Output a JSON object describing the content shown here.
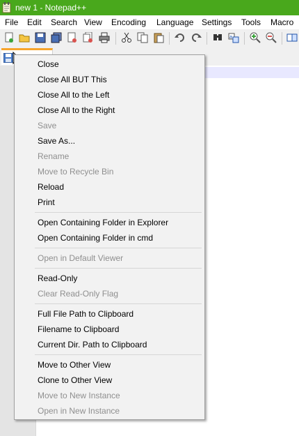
{
  "window": {
    "title": "new 1 - Notepad++"
  },
  "menubar": {
    "items": [
      "File",
      "Edit",
      "Search",
      "View",
      "Encoding",
      "Language",
      "Settings",
      "Tools",
      "Macro"
    ]
  },
  "toolbar": {
    "icons": [
      "new-file-icon",
      "open-file-icon",
      "save-icon",
      "save-all-icon",
      "close-icon",
      "close-all-icon",
      "print-icon",
      "cut-icon",
      "copy-icon",
      "paste-icon",
      "undo-icon",
      "redo-icon",
      "find-icon",
      "replace-icon",
      "zoom-in-icon",
      "zoom-out-icon",
      "sync-view-icon"
    ]
  },
  "context_menu": {
    "groups": [
      [
        {
          "label": "Close",
          "enabled": true
        },
        {
          "label": "Close All BUT This",
          "enabled": true
        },
        {
          "label": "Close All to the Left",
          "enabled": true
        },
        {
          "label": "Close All to the Right",
          "enabled": true
        },
        {
          "label": "Save",
          "enabled": false
        },
        {
          "label": "Save As...",
          "enabled": true
        },
        {
          "label": "Rename",
          "enabled": false
        },
        {
          "label": "Move to Recycle Bin",
          "enabled": false
        },
        {
          "label": "Reload",
          "enabled": true
        },
        {
          "label": "Print",
          "enabled": true
        }
      ],
      [
        {
          "label": "Open Containing Folder in Explorer",
          "enabled": true
        },
        {
          "label": "Open Containing Folder in cmd",
          "enabled": true
        }
      ],
      [
        {
          "label": "Open in Default Viewer",
          "enabled": false
        }
      ],
      [
        {
          "label": "Read-Only",
          "enabled": true
        },
        {
          "label": "Clear Read-Only Flag",
          "enabled": false
        }
      ],
      [
        {
          "label": "Full File Path to Clipboard",
          "enabled": true
        },
        {
          "label": "Filename to Clipboard",
          "enabled": true
        },
        {
          "label": "Current Dir. Path to Clipboard",
          "enabled": true
        }
      ],
      [
        {
          "label": "Move to Other View",
          "enabled": true
        },
        {
          "label": "Clone to Other View",
          "enabled": true
        },
        {
          "label": "Move to New Instance",
          "enabled": false
        },
        {
          "label": "Open in New Instance",
          "enabled": false
        }
      ]
    ]
  },
  "colors": {
    "titlebar": "#49a81c",
    "active_tab_accent": "#f7a52c",
    "disabled_text": "#8f8f8f",
    "current_line": "#e8e8ff"
  }
}
